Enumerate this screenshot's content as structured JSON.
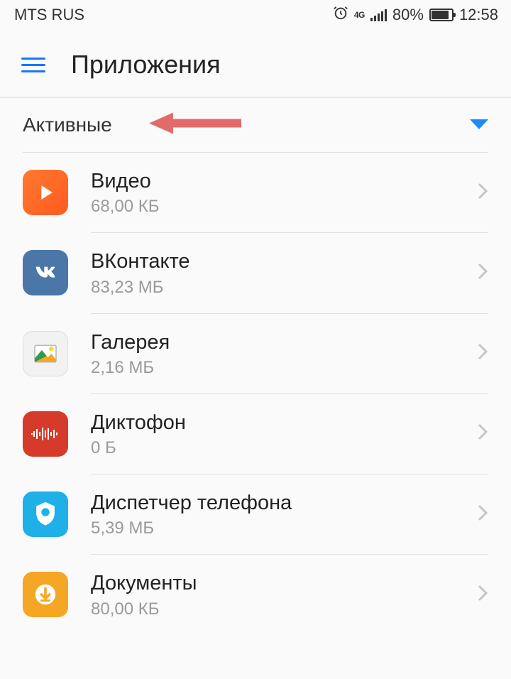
{
  "status": {
    "carrier": "MTS RUS",
    "network": "4G",
    "battery_pct": "80%",
    "time": "12:58"
  },
  "header": {
    "title": "Приложения"
  },
  "filter": {
    "label": "Активные"
  },
  "apps": [
    {
      "name": "Видео",
      "size": "68,00 КБ"
    },
    {
      "name": "ВКонтакте",
      "size": "83,23 МБ"
    },
    {
      "name": "Галерея",
      "size": "2,16 МБ"
    },
    {
      "name": "Диктофон",
      "size": "0 Б"
    },
    {
      "name": "Диспетчер телефона",
      "size": "5,39 МБ"
    },
    {
      "name": "Документы",
      "size": "80,00 КБ"
    }
  ]
}
